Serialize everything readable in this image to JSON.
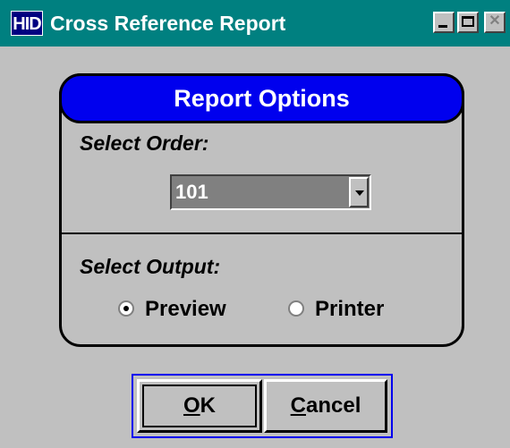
{
  "window": {
    "icon_text": "HID",
    "title": "Cross Reference Report"
  },
  "panel": {
    "title": "Report Options",
    "select_order_label": "Select Order:",
    "order_value": "101",
    "select_output_label": "Select Output:",
    "outputs": [
      {
        "label": "Preview",
        "selected": true
      },
      {
        "label": "Printer",
        "selected": false
      }
    ]
  },
  "buttons": {
    "ok_access_key": "O",
    "ok_rest": "K",
    "cancel_access_key": "C",
    "cancel_rest": "ancel"
  },
  "colors": {
    "titlebar": "#008080",
    "header": "#0000ee",
    "face": "#c0c0c0"
  }
}
